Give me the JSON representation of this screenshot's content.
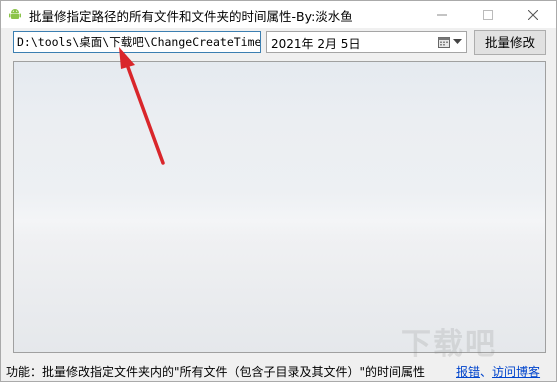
{
  "window": {
    "title": "批量修指定路径的所有文件和文件夹的时间属性-By:淡水鱼",
    "app_icon": "android-icon",
    "controls": {
      "minimize_icon": "minimize-icon",
      "maximize_icon": "maximize-icon",
      "close_icon": "close-icon"
    }
  },
  "toolbar": {
    "path_value": "D:\\tools\\桌面\\下载吧\\ChangeCreateTime",
    "date_value": "2021年 2月 5日",
    "calendar_icon": "calendar-icon",
    "dropdown_icon": "chevron-down-icon",
    "batch_button_label": "批量修改"
  },
  "status": {
    "description": "功能：批量修改指定文件夹内的\"所有文件（包含子目录及其文件）\"的时间属性",
    "link_report": "报错",
    "separator": "、",
    "link_blog": "访问博客"
  },
  "overlay": {
    "watermark": "下载吧",
    "arrow_color": "#d9262b"
  },
  "colors": {
    "accent_border": "#3c7fb1",
    "link": "#0044cc"
  }
}
